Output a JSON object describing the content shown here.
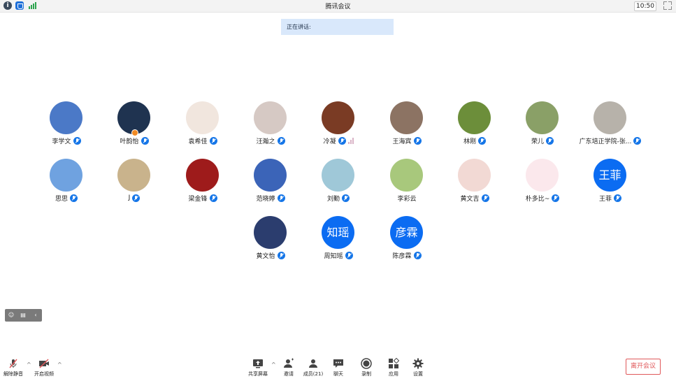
{
  "window": {
    "title": "腾讯会议",
    "clock": "10:50"
  },
  "speaking": {
    "label": "正在讲话:"
  },
  "participants": [
    {
      "name": "李学文",
      "avatar": "photo",
      "color": "#4b79c7",
      "mic": true
    },
    {
      "name": "叶韵怡",
      "avatar": "photo",
      "color": "#1f3350",
      "mic": true,
      "host": true
    },
    {
      "name": "袁希佳",
      "avatar": "photo",
      "color": "#f1e6de",
      "mic": true
    },
    {
      "name": "汪瀚之",
      "avatar": "photo",
      "color": "#d6c9c4",
      "mic": true
    },
    {
      "name": "冷凝",
      "avatar": "photo",
      "color": "#7a3b24",
      "mic": true,
      "speaking_bars": true
    },
    {
      "name": "王海宾",
      "avatar": "photo",
      "color": "#8c7363",
      "mic": true
    },
    {
      "name": "林刚",
      "avatar": "photo",
      "color": "#6c8e3a",
      "mic": true
    },
    {
      "name": "荣儿",
      "avatar": "photo",
      "color": "#8aa067",
      "mic": true
    },
    {
      "name": "广东培正学院-张...",
      "avatar": "photo",
      "color": "#b7b2aa",
      "mic": true
    },
    {
      "name": "思思",
      "avatar": "photo",
      "color": "#6fa2e0",
      "mic": true
    },
    {
      "name": "J",
      "avatar": "photo",
      "color": "#c9b38c",
      "mic": true
    },
    {
      "name": "梁金锋",
      "avatar": "photo",
      "color": "#9e1b1b",
      "mic": true
    },
    {
      "name": "范晓婷",
      "avatar": "photo",
      "color": "#3b64b8",
      "mic": true
    },
    {
      "name": "刘勤",
      "avatar": "photo",
      "color": "#9fc8d8",
      "mic": true
    },
    {
      "name": "李彩云",
      "avatar": "photo",
      "color": "#a8c87c",
      "mic": false
    },
    {
      "name": "黄文吉",
      "avatar": "photo",
      "color": "#f2d9d4",
      "mic": true
    },
    {
      "name": "朴多比~",
      "avatar": "photo",
      "color": "#fbe8ec",
      "mic": true
    },
    {
      "name": "王菲",
      "avatar": "text",
      "avatar_text": "王菲",
      "color": "#0b6cf2",
      "mic": true
    },
    {
      "name": "黄文怡",
      "avatar": "photo",
      "color": "#2b3d6e",
      "mic": true
    },
    {
      "name": "周知瑶",
      "avatar": "text",
      "avatar_text": "知瑶",
      "color": "#0b6cf2",
      "mic": true
    },
    {
      "name": "陈彦霖",
      "avatar": "text",
      "avatar_text": "彦霖",
      "color": "#0b6cf2",
      "mic": true
    }
  ],
  "toolbar": {
    "unmute": "解除静音",
    "start_video": "开启视频",
    "share_screen": "共享屏幕",
    "invite": "邀请",
    "members": "成员(21)",
    "chat": "聊天",
    "record": "录制",
    "apps": "应用",
    "settings": "设置",
    "leave": "离开会议"
  },
  "colors": {
    "accent": "#1676e8",
    "leave": "#e0585a",
    "speaking_bg": "#d9e8fb"
  }
}
